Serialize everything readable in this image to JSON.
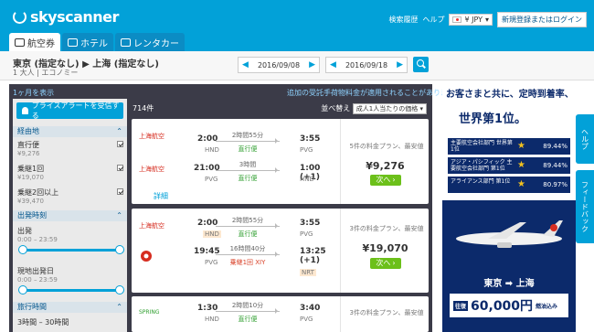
{
  "header": {
    "logo": "skyscanner",
    "links": [
      "検索履歴",
      "ヘルプ"
    ],
    "currency": "¥ JPY",
    "login": "新規登録またはログイン"
  },
  "tabs": [
    "航空券",
    "ホテル",
    "レンタカー"
  ],
  "search": {
    "route": "東京 (指定なし) ▶ 上海 (指定なし)",
    "pax": "1 大人 | エコノミー",
    "depart_date": "2016/09/08",
    "return_date": "2016/09/18"
  },
  "strip": {
    "left": "1ヶ月を表示",
    "right": "追加の受託手荷物料金が適用されることがあります"
  },
  "filters": {
    "alert": "プライスアラートを受信する",
    "stops_title": "経由地",
    "stops": [
      {
        "label": "直行便",
        "price": "¥9,276"
      },
      {
        "label": "乗継1回",
        "price": "¥19,070"
      },
      {
        "label": "乗継2回以上",
        "price": "¥39,470"
      }
    ],
    "times_title": "出発時刻",
    "depart_label": "出発",
    "depart_range": "0:00 – 23:59",
    "return_label": "現地出発日",
    "return_range": "0:00 – 23:59",
    "duration_title": "旅行時間",
    "duration_range": "3時間 – 30時間"
  },
  "results": {
    "count": "714件",
    "sort_label": "並べ替え",
    "sort_value": "成人1人当たりの価格"
  },
  "cards": [
    {
      "legs": [
        {
          "dep": "2:00",
          "dep_code": "HND",
          "dur": "2時間55分",
          "stop": "直行便",
          "arr": "3:55",
          "arr_code": "PVG"
        },
        {
          "dep": "21:00",
          "dep_code": "PVG",
          "dur": "3時間",
          "stop": "直行便",
          "arr": "1:00 (+1)",
          "arr_code": "HND"
        }
      ],
      "details": "詳細",
      "plans": "5件の料金プラン、最安値",
      "price": "¥9,276",
      "go": "次へ"
    },
    {
      "legs": [
        {
          "dep": "2:00",
          "dep_code": "HND",
          "dur": "2時間55分",
          "stop": "直行便",
          "arr": "3:55",
          "arr_code": "PVG"
        },
        {
          "dep": "19:45",
          "dep_code": "PVG",
          "dur": "16時間40分",
          "stop": "乗継1回 XIY",
          "arr": "13:25 (+1)",
          "arr_code": "NRT"
        }
      ],
      "details": "詳細",
      "plans": "3件の料金プラン、最安値",
      "price": "¥19,070",
      "go": "次へ"
    },
    {
      "legs": [
        {
          "dep": "1:30",
          "dep_code": "HND",
          "dur": "2時間10分",
          "stop": "直行便",
          "arr": "3:40",
          "arr_code": "PVG"
        }
      ],
      "plans": "3件の料金プラン、最安値"
    }
  ],
  "ad": {
    "title": "お客さまと共に、定時到着率、",
    "headline": "世界第1位。",
    "awards": [
      {
        "label": "主要航空会社部門 世界第1位",
        "pct": "89.44%"
      },
      {
        "label": "アジア・パシフィック 主要航空会社部門 第1位",
        "pct": "89.44%"
      },
      {
        "label": "アライアンス部門 第1位",
        "pct": "80.97%"
      }
    ],
    "route": "東京 ➡ 上海",
    "fare_tag": "往復",
    "fare": "60,000円",
    "fare_tail": "燃油込み"
  },
  "side_tabs": [
    "ヘルプ",
    "フィードバック"
  ]
}
